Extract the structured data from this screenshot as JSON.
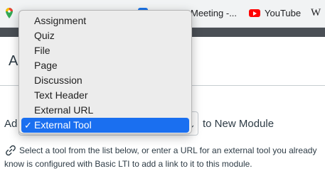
{
  "browser": {
    "bookmarks": {
      "meeting": "Meeting -...",
      "youtube": "YouTube",
      "w": "W"
    }
  },
  "page": {
    "heading": "Ad",
    "add_prefix": "Ad",
    "select_caret": "⌄",
    "to_module": "to New Module",
    "help_text": "Select a tool from the list below, or enter a URL for an external tool you already know is configured with Basic LTI to add a link to it to this module."
  },
  "dropdown": {
    "check_mark": "✓",
    "options": [
      "Assignment",
      "Quiz",
      "File",
      "Page",
      "Discussion",
      "Text Header",
      "External URL",
      "External Tool"
    ],
    "selected": "External Tool"
  },
  "colors": {
    "selected_option": "#1a6ff0",
    "dark_band": "#4a4f55",
    "text": "#2d3b45"
  }
}
